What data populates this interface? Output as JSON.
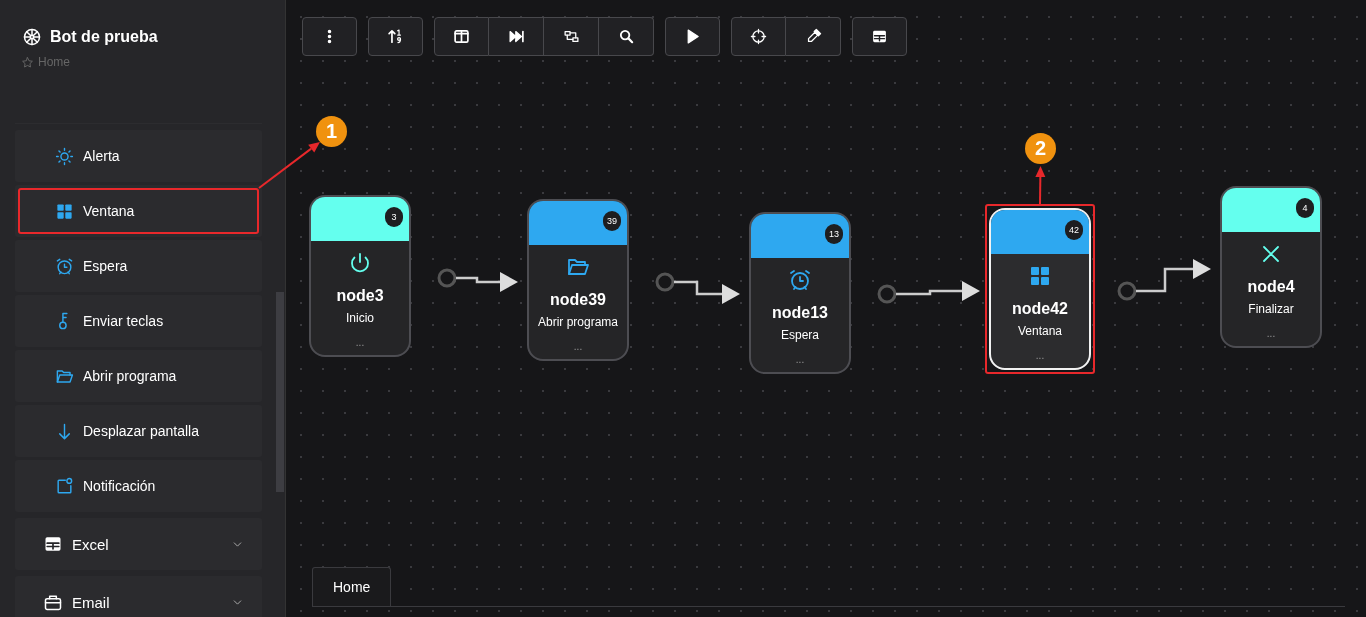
{
  "app": {
    "title": "Bot de prueba",
    "breadcrumb": "Home"
  },
  "sidebar": {
    "items": [
      {
        "label": "Alerta",
        "kind": "action",
        "highlighted": false
      },
      {
        "label": "Ventana",
        "kind": "action",
        "highlighted": true
      },
      {
        "label": "Espera",
        "kind": "action",
        "highlighted": false
      },
      {
        "label": "Enviar teclas",
        "kind": "action",
        "highlighted": false
      },
      {
        "label": "Abrir programa",
        "kind": "action",
        "highlighted": false
      },
      {
        "label": "Desplazar pantalla",
        "kind": "action",
        "highlighted": false
      },
      {
        "label": "Notificación",
        "kind": "action",
        "highlighted": false
      },
      {
        "label": "Excel",
        "kind": "group",
        "expanded": false,
        "highlighted": false
      },
      {
        "label": "Email",
        "kind": "group",
        "expanded": false,
        "highlighted": false
      }
    ]
  },
  "canvas": {
    "nodes": [
      {
        "name": "node3",
        "subtitle": "Inicio",
        "badge": "3",
        "more": "...",
        "color": "#64ffee",
        "selected": false,
        "highlighted": false
      },
      {
        "name": "node39",
        "subtitle": "Abrir programa",
        "badge": "39",
        "more": "...",
        "color": "#2ea8f0",
        "selected": false,
        "highlighted": false
      },
      {
        "name": "node13",
        "subtitle": "Espera",
        "badge": "13",
        "more": "...",
        "color": "#2ea8f0",
        "selected": false,
        "highlighted": false
      },
      {
        "name": "node42",
        "subtitle": "Ventana",
        "badge": "42",
        "more": "...",
        "color": "#2ea8f0",
        "selected": true,
        "highlighted": true
      },
      {
        "name": "node4",
        "subtitle": "Finalizar",
        "badge": "4",
        "more": "...",
        "color": "#64ffee",
        "selected": false,
        "highlighted": false
      }
    ]
  },
  "tabs": [
    {
      "label": "Home",
      "selected": true
    }
  ],
  "annotations": [
    {
      "label": "1"
    },
    {
      "label": "2"
    }
  ]
}
